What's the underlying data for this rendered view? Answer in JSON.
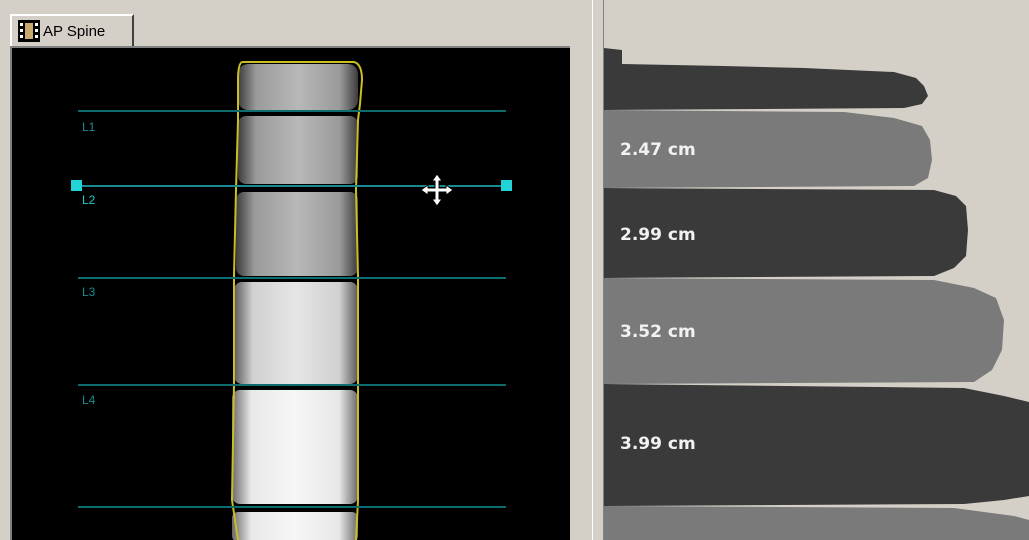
{
  "tab": {
    "label": "AP Spine",
    "icon": "film-strip-icon"
  },
  "vertebrae": {
    "labels": [
      "L1",
      "L2",
      "L3",
      "L4"
    ],
    "line_color": "#0e6b6e",
    "roi_color": "#c8c020",
    "handle_color": "#22d3d8"
  },
  "cursor": {
    "icon": "move-cursor-icon"
  },
  "heights": {
    "values": [
      "2.47 cm",
      "2.99 cm",
      "3.52 cm",
      "3.99 cm"
    ],
    "band_colors": [
      "#7a7a7a",
      "#3a3a3a",
      "#7a7a7a",
      "#3a3a3a"
    ]
  }
}
